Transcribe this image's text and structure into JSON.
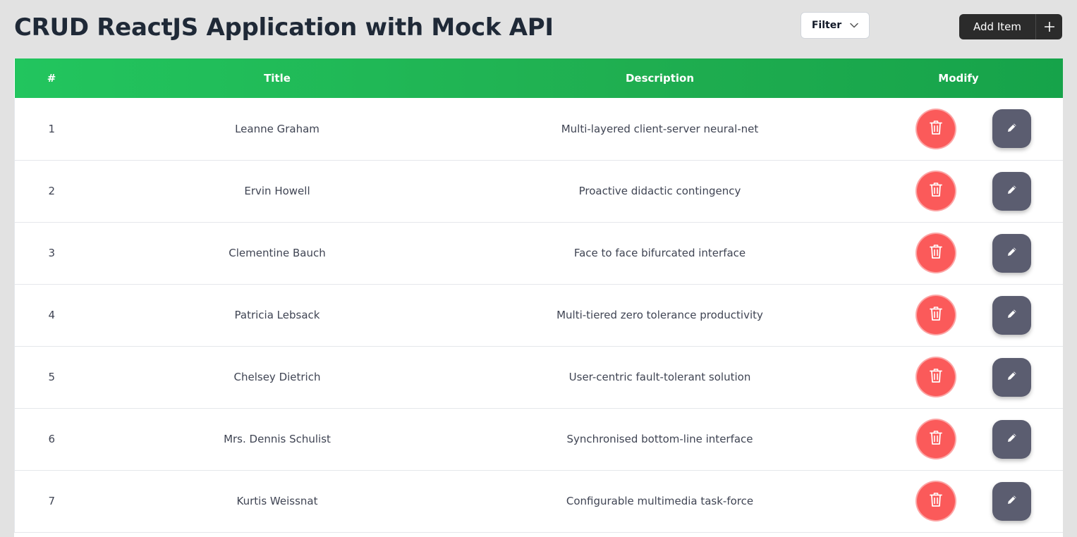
{
  "header": {
    "title": "CRUD ReactJS Application with Mock API",
    "filter_label": "Filter",
    "add_label": "Add Item"
  },
  "table": {
    "columns": [
      "#",
      "Title",
      "Description",
      "Modify"
    ],
    "rows": [
      {
        "id": "1",
        "title": "Leanne Graham",
        "description": "Multi-layered client-server neural-net"
      },
      {
        "id": "2",
        "title": "Ervin Howell",
        "description": "Proactive didactic contingency"
      },
      {
        "id": "3",
        "title": "Clementine Bauch",
        "description": "Face to face bifurcated interface"
      },
      {
        "id": "4",
        "title": "Patricia Lebsack",
        "description": "Multi-tiered zero tolerance productivity"
      },
      {
        "id": "5",
        "title": "Chelsey Dietrich",
        "description": "User-centric fault-tolerant solution"
      },
      {
        "id": "6",
        "title": "Mrs. Dennis Schulist",
        "description": "Synchronised bottom-line interface"
      },
      {
        "id": "7",
        "title": "Kurtis Weissnat",
        "description": "Configurable multimedia task-force"
      }
    ]
  },
  "icons": {
    "filter": "chevron-down-icon",
    "add": "plus-icon",
    "delete": "trash-icon",
    "edit": "pencil-icon"
  },
  "colors": {
    "header_gradient_start": "#22c55e",
    "header_gradient_end": "#16a34a",
    "delete_button": "#fb5a5a",
    "edit_button": "#5b5d70",
    "add_button": "#2b2b2b",
    "page_background": "#e2e2e2"
  }
}
